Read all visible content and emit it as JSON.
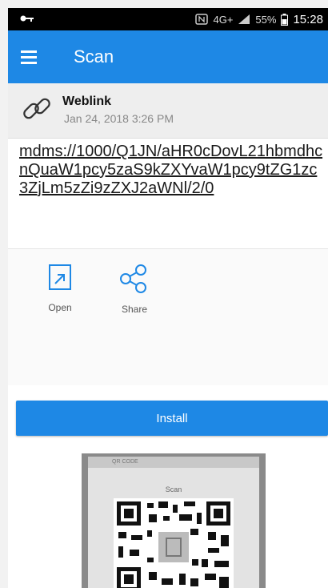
{
  "status_bar": {
    "network": "4G+",
    "battery": "55%",
    "time": "15:28"
  },
  "app_bar": {
    "title": "Scan"
  },
  "history_item": {
    "type": "Weblink",
    "date": "Jan 24, 2018 3:26 PM"
  },
  "scan_content": "mdms://1000/Q1JN/aHR0cDovL21hbmdhcnQuaW1pcy5zaS9kZXYvaW1pcy9tZG1zc3ZjLm5zZi9zZXJ2aWNl/2/0",
  "actions": [
    {
      "label": "Open",
      "icon": "open-external-icon"
    },
    {
      "label": "Share",
      "icon": "share-icon"
    }
  ],
  "install_button": {
    "label": "Install"
  },
  "qr_preview": {
    "screen_header": "QR CODE",
    "screen_title": "Scan"
  },
  "colors": {
    "accent": "#1e88e5",
    "status_bar": "#000000",
    "history_bg": "#eeeeee"
  }
}
